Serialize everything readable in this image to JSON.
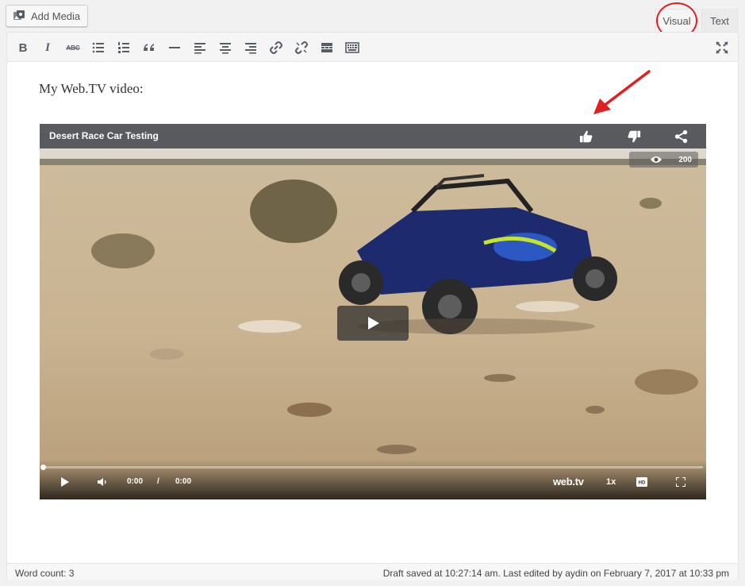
{
  "toolbar_top": {
    "add_media_label": "Add Media",
    "tabs": [
      {
        "label": "Visual",
        "active": true
      },
      {
        "label": "Text",
        "active": false
      }
    ]
  },
  "format_toolbar": {
    "buttons": [
      "bold",
      "italic",
      "strikethrough",
      "bulleted-list",
      "numbered-list",
      "blockquote",
      "horizontal-line",
      "align-left",
      "align-center",
      "align-right",
      "insert-link",
      "remove-link",
      "read-more",
      "toolbar-toggle",
      "fullscreen"
    ],
    "bold_glyph": "B",
    "italic_glyph": "I",
    "strike_glyph": "ABC"
  },
  "content": {
    "intro_text": "My Web.TV video:"
  },
  "video": {
    "title": "Desert Race Car Testing",
    "view_count": "200",
    "current_time": "0:00",
    "time_separator": "/",
    "duration": "0:00",
    "brand": "web.tv",
    "speed": "1x",
    "progress": 0,
    "icons": [
      "thumbs-up-icon",
      "thumbs-down-icon",
      "share-icon",
      "eye-icon",
      "play-icon",
      "volume-icon",
      "hd-icon",
      "fullscreen-icon"
    ]
  },
  "status_bar": {
    "word_count": "Word count: 3",
    "saved_text": "Draft saved at 10:27:14 am. Last edited by aydin on February 7, 2017 at 10:33 pm"
  },
  "colors": {
    "annotation_red": "#e02020",
    "header_bar": "#46484c"
  }
}
